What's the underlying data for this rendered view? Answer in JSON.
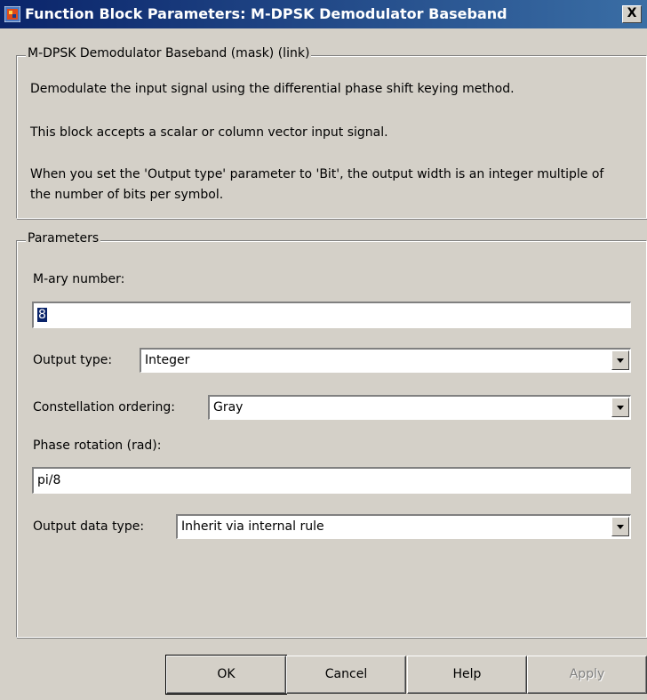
{
  "window": {
    "title": "Function Block Parameters: M-DPSK Demodulator Baseband",
    "close_label": "X",
    "icon": "matlab-block-icon"
  },
  "description": {
    "group_title": "M-DPSK Demodulator Baseband (mask) (link)",
    "lines": [
      "Demodulate the input signal using the differential phase shift keying method.",
      "This block accepts a scalar or column vector input signal.",
      "When you set the 'Output type' parameter to 'Bit', the output width is an integer multiple of the number of bits per symbol."
    ]
  },
  "parameters": {
    "group_title": "Parameters",
    "mary_label": "M-ary number:",
    "mary_value": "8",
    "output_type_label": "Output type:",
    "output_type_value": "Integer",
    "constellation_label": "Constellation ordering:",
    "constellation_value": "Gray",
    "phase_label": "Phase rotation (rad):",
    "phase_value": "pi/8",
    "output_data_type_label": "Output data type:",
    "output_data_type_value": "Inherit via internal rule"
  },
  "buttons": {
    "ok": "OK",
    "cancel": "Cancel",
    "help": "Help",
    "apply": "Apply"
  }
}
